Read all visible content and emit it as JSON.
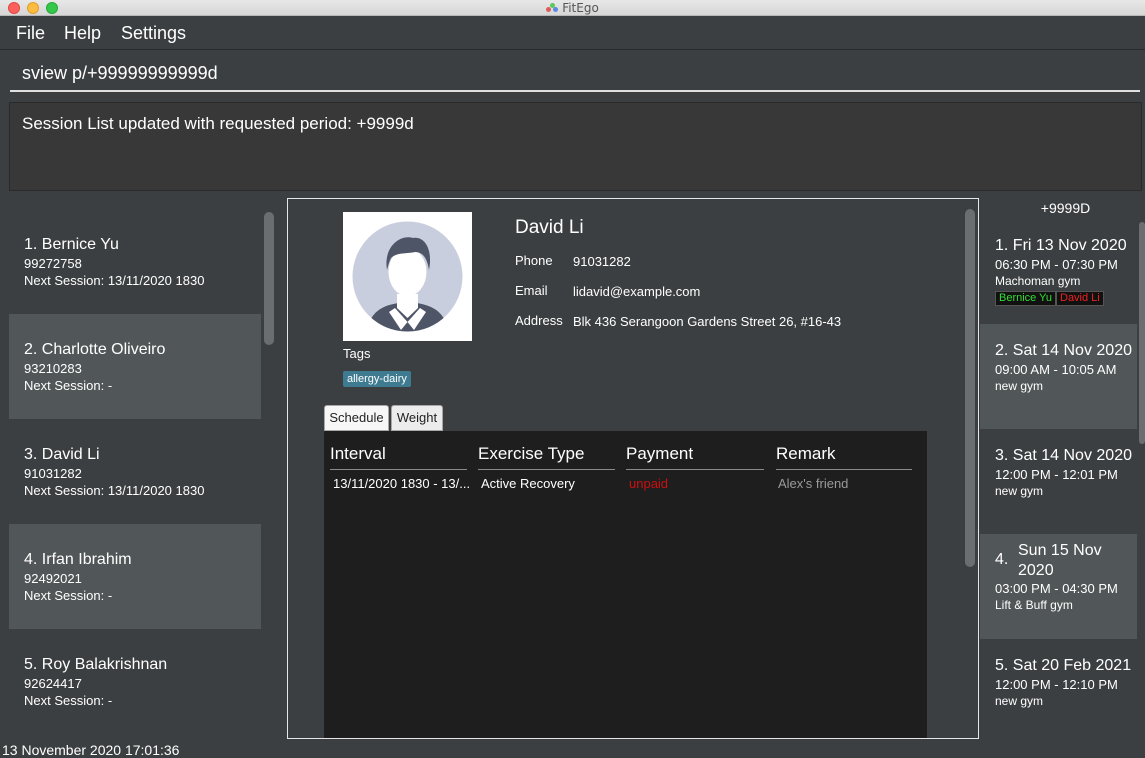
{
  "window": {
    "title": "FitEgo"
  },
  "menu": {
    "file": "File",
    "help": "Help",
    "settings": "Settings"
  },
  "command": {
    "value": "sview p/+99999999999d"
  },
  "result": {
    "text": "Session List updated with requested period: +9999d"
  },
  "clients": [
    {
      "name": "1.  Bernice Yu",
      "phone": "99272758",
      "next": "Next Session: 13/11/2020 1830"
    },
    {
      "name": "2.  Charlotte Oliveiro",
      "phone": "93210283",
      "next": "Next Session:  -"
    },
    {
      "name": "3.  David Li",
      "phone": "91031282",
      "next": "Next Session: 13/11/2020 1830"
    },
    {
      "name": "4.  Irfan Ibrahim",
      "phone": "92492021",
      "next": "Next Session:  -"
    },
    {
      "name": "5.  Roy Balakrishnan",
      "phone": "92624417",
      "next": "Next Session:  -"
    }
  ],
  "profile": {
    "name": "David Li",
    "phone_label": "Phone",
    "phone": "91031282",
    "email_label": "Email",
    "email": "lidavid@example.com",
    "address_label": "Address",
    "address": "Blk 436 Serangoon Gardens Street 26, #16-43",
    "tags_label": "Tags",
    "tags": [
      "allergy-dairy"
    ]
  },
  "tabs": {
    "schedule": "Schedule",
    "weight": "Weight"
  },
  "schedule_table": {
    "headers": [
      "Interval",
      "Exercise Type",
      "Payment",
      "Remark"
    ],
    "rows": [
      [
        "13/11/2020 1830 - 13/...",
        "Active Recovery",
        "unpaid",
        "Alex's friend"
      ]
    ]
  },
  "session_panel": {
    "period": "+9999D"
  },
  "sessions": [
    {
      "title": "1.  Fri 13 Nov 2020",
      "time": "06:30 PM - 07:30 PM",
      "gym": "Machoman gym",
      "clients": [
        "Bernice Yu",
        "David Li"
      ],
      "client_colors": [
        "#33dd33",
        "#ee2222"
      ]
    },
    {
      "title": "2.  Sat 14 Nov 2020",
      "time": "09:00 AM - 10:05 AM",
      "gym": "new gym"
    },
    {
      "title": "3.  Sat 14 Nov 2020",
      "time": "12:00 PM - 12:01 PM",
      "gym": "new gym"
    },
    {
      "title_num": "4.",
      "title_date": "Sun 15 Nov 2020",
      "time": "03:00 PM - 04:30 PM",
      "gym": "Lift & Buff gym"
    },
    {
      "title": "5.  Sat 20 Feb 2021",
      "time": "12:00 PM - 12:10 PM",
      "gym": "new gym"
    }
  ],
  "status": {
    "datetime": "13 November 2020 17:01:36"
  },
  "colors": {
    "background": "#3c3f41",
    "list_highlight": "#515658",
    "tag": "#3e7b91",
    "unpaid": "#cc1010"
  }
}
